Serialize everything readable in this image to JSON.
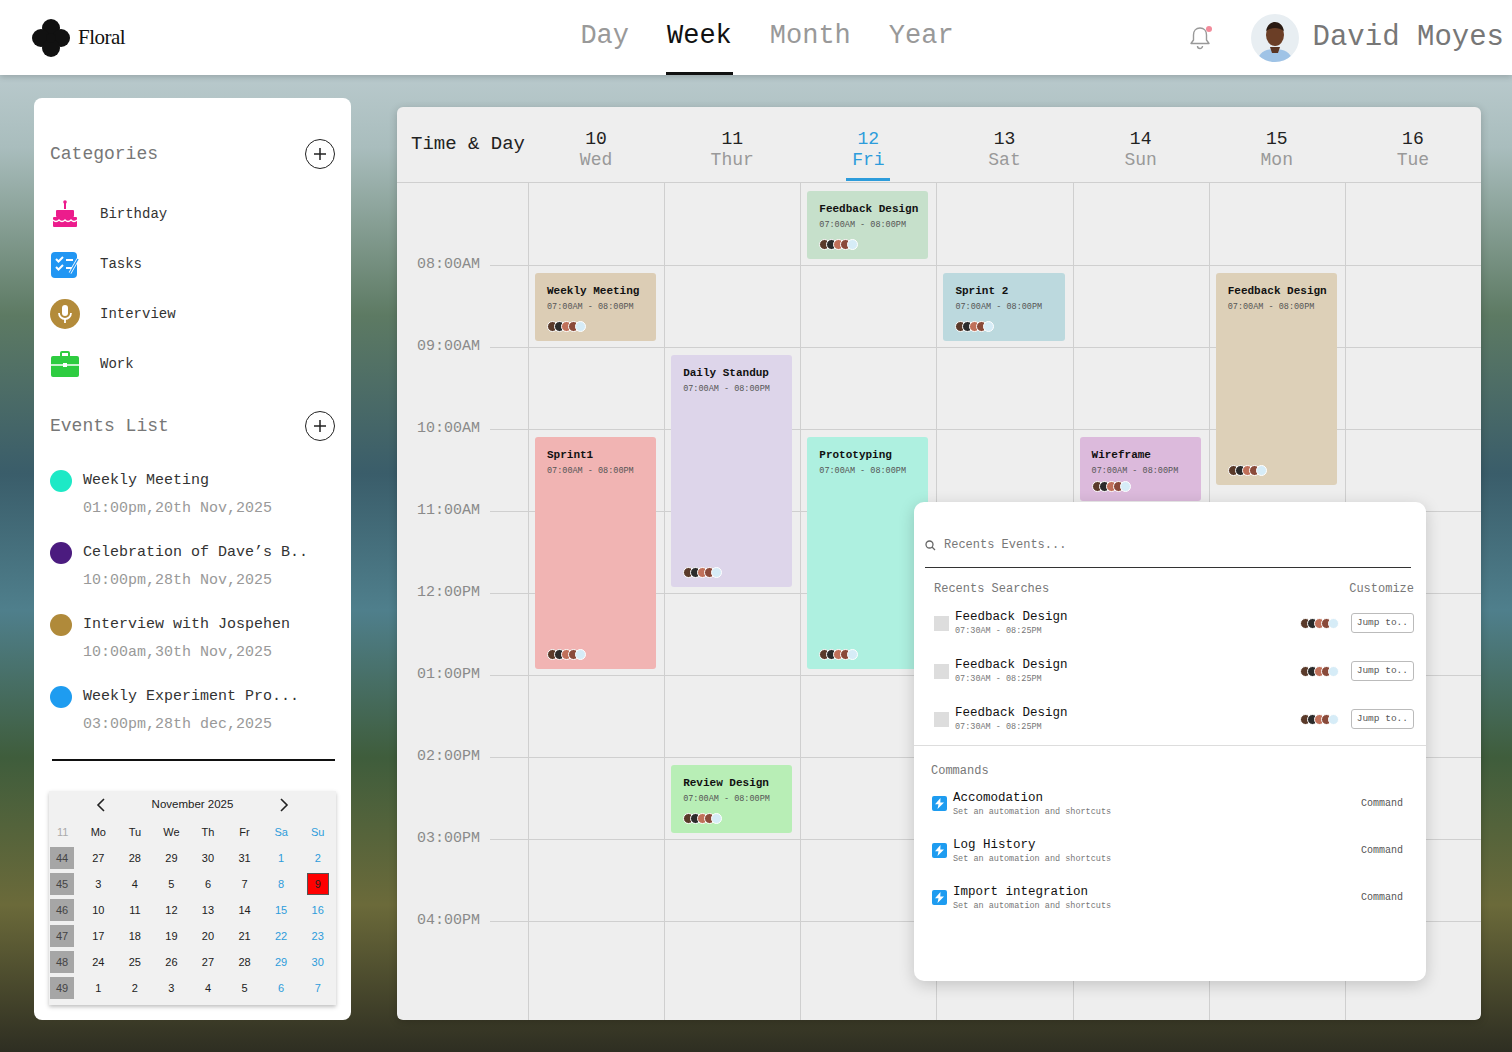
{
  "app": {
    "name": "Floral"
  },
  "views": [
    {
      "label": "Day",
      "selected": false
    },
    {
      "label": "Week",
      "selected": true
    },
    {
      "label": "Month",
      "selected": false
    },
    {
      "label": "Year",
      "selected": false
    }
  ],
  "notifications": {
    "unread": true
  },
  "user": {
    "name": "David Moyes"
  },
  "categories": {
    "title": "Categories",
    "items": [
      {
        "label": "Birthday",
        "color": "#ec1c8c"
      },
      {
        "label": "Tasks",
        "color": "#2196f3"
      },
      {
        "label": "Interview",
        "color": "#b38b3a"
      },
      {
        "label": "Work",
        "color": "#2ecc40"
      }
    ]
  },
  "events_list": {
    "title": "Events List",
    "items": [
      {
        "title": "Weekly Meeting",
        "time": "01:00pm,20th Nov,2025",
        "color": "#1de9c6"
      },
      {
        "title": "Celebration of Dave’s B..",
        "time": "10:00pm,28th Nov,2025",
        "color": "#4b1b7f"
      },
      {
        "title": "Interview with Jospehen",
        "time": "10:00am,30th Nov,2025",
        "color": "#b08a3a"
      },
      {
        "title": "Weekly Experiment Pro...",
        "time": "03:00pm,28th dec,2025",
        "color": "#1e9cf0"
      }
    ]
  },
  "mini_calendar": {
    "month": "November 2025",
    "week_header": "11",
    "weekdays": [
      "Mo",
      "Tu",
      "We",
      "Th",
      "Fr",
      "Sa",
      "Su"
    ],
    "weeks": [
      {
        "number": "44",
        "days": [
          {
            "label": "27",
            "selected": false
          },
          {
            "label": "28",
            "selected": false
          },
          {
            "label": "29",
            "selected": false
          },
          {
            "label": "30",
            "selected": false
          },
          {
            "label": "31",
            "selected": false
          },
          {
            "label": "1",
            "selected": false
          },
          {
            "label": "2",
            "selected": false
          }
        ]
      },
      {
        "number": "45",
        "days": [
          {
            "label": "3",
            "selected": false
          },
          {
            "label": "4",
            "selected": false
          },
          {
            "label": "5",
            "selected": false
          },
          {
            "label": "6",
            "selected": false
          },
          {
            "label": "7",
            "selected": false
          },
          {
            "label": "8",
            "selected": false
          },
          {
            "label": "9",
            "selected": true
          }
        ]
      },
      {
        "number": "46",
        "days": [
          {
            "label": "10",
            "selected": false
          },
          {
            "label": "11",
            "selected": false
          },
          {
            "label": "12",
            "selected": false
          },
          {
            "label": "13",
            "selected": false
          },
          {
            "label": "14",
            "selected": false
          },
          {
            "label": "15",
            "selected": false
          },
          {
            "label": "16",
            "selected": false
          }
        ]
      },
      {
        "number": "47",
        "days": [
          {
            "label": "17",
            "selected": false
          },
          {
            "label": "18",
            "selected": false
          },
          {
            "label": "19",
            "selected": false
          },
          {
            "label": "20",
            "selected": false
          },
          {
            "label": "21",
            "selected": false
          },
          {
            "label": "22",
            "selected": false
          },
          {
            "label": "23",
            "selected": false
          }
        ]
      },
      {
        "number": "48",
        "days": [
          {
            "label": "24",
            "selected": false
          },
          {
            "label": "25",
            "selected": false
          },
          {
            "label": "26",
            "selected": false
          },
          {
            "label": "27",
            "selected": false
          },
          {
            "label": "28",
            "selected": false
          },
          {
            "label": "29",
            "selected": false
          },
          {
            "label": "30",
            "selected": false
          }
        ]
      },
      {
        "number": "49",
        "days": [
          {
            "label": "1",
            "selected": false
          },
          {
            "label": "2",
            "selected": false
          },
          {
            "label": "3",
            "selected": false
          },
          {
            "label": "4",
            "selected": false
          },
          {
            "label": "5",
            "selected": false
          },
          {
            "label": "6",
            "selected": false
          },
          {
            "label": "7",
            "selected": false
          }
        ]
      }
    ]
  },
  "week_view": {
    "corner": "Time & Day",
    "days": [
      {
        "number": "10",
        "weekday": "Wed",
        "selected": false
      },
      {
        "number": "11",
        "weekday": "Thur",
        "selected": false
      },
      {
        "number": "12",
        "weekday": "Fri",
        "selected": true
      },
      {
        "number": "13",
        "weekday": "Sat",
        "selected": false
      },
      {
        "number": "14",
        "weekday": "Sun",
        "selected": false
      },
      {
        "number": "15",
        "weekday": "Mon",
        "selected": false
      },
      {
        "number": "16",
        "weekday": "Tue",
        "selected": false
      }
    ],
    "hours": [
      "08:00AM",
      "09:00AM",
      "10:00AM",
      "11:00AM",
      "12:00PM",
      "01:00PM",
      "02:00PM",
      "03:00PM",
      "04:00PM"
    ],
    "events": [
      {
        "title": "Feedback Design",
        "time": "07:00AM - 08:00PM",
        "day": "12",
        "start": 7,
        "end": 8,
        "color": "#c6e0cb"
      },
      {
        "title": "Weekly Meeting",
        "time": "07:00AM - 08:00PM",
        "day": "10",
        "start": 8,
        "end": 9,
        "color": "#dccdb5"
      },
      {
        "title": "Sprint 2",
        "time": "07:00AM - 08:00PM",
        "day": "13",
        "start": 8,
        "end": 9,
        "color": "#bcd9de"
      },
      {
        "title": "Feedback Design",
        "time": "07:00AM - 08:00PM",
        "day": "15",
        "start": 8,
        "end": 10.75,
        "color": "#ddd0b8"
      },
      {
        "title": "Daily Standup",
        "time": "07:00AM - 08:00PM",
        "day": "11",
        "start": 9,
        "end": 12,
        "color": "#ddd5ea"
      },
      {
        "title": "Sprint1",
        "time": "07:00AM - 08:00PM",
        "day": "10",
        "start": 10,
        "end": 13,
        "color": "#f1b4b3"
      },
      {
        "title": "Prototyping",
        "time": "07:00AM - 08:00PM",
        "day": "12",
        "start": 10,
        "end": 13,
        "color": "#aef0e0"
      },
      {
        "title": "Wireframe",
        "time": "07:00AM - 08:00PM",
        "day": "14",
        "start": 10,
        "end": 10.95,
        "color": "#dcbadc"
      },
      {
        "title": "Review Design",
        "time": "07:00AM - 08:00PM",
        "day": "11",
        "start": 14,
        "end": 15,
        "color": "#b8eeb6"
      }
    ]
  },
  "search_popup": {
    "placeholder": "Recents Events...",
    "recents_title": "Recents Searches",
    "customize": "Customize",
    "recents": [
      {
        "title": "Feedback Design",
        "time": "07:30AM - 08:25PM",
        "checked": false,
        "action": "Jump to.."
      },
      {
        "title": "Feedback Design",
        "time": "07:30AM - 08:25PM",
        "checked": false,
        "action": "Jump to.."
      },
      {
        "title": "Feedback Design",
        "time": "07:30AM - 08:25PM",
        "checked": false,
        "action": "Jump to.."
      }
    ],
    "commands_title": "Commands",
    "commands": [
      {
        "title": "Accomodation",
        "subtitle": "Set an automation and shortcuts",
        "action": "Command"
      },
      {
        "title": "Log History",
        "subtitle": "Set an automation and shortcuts",
        "action": "Command"
      },
      {
        "title": "Import integration",
        "subtitle": "Set an automation and shortcuts",
        "action": "Command"
      }
    ]
  }
}
